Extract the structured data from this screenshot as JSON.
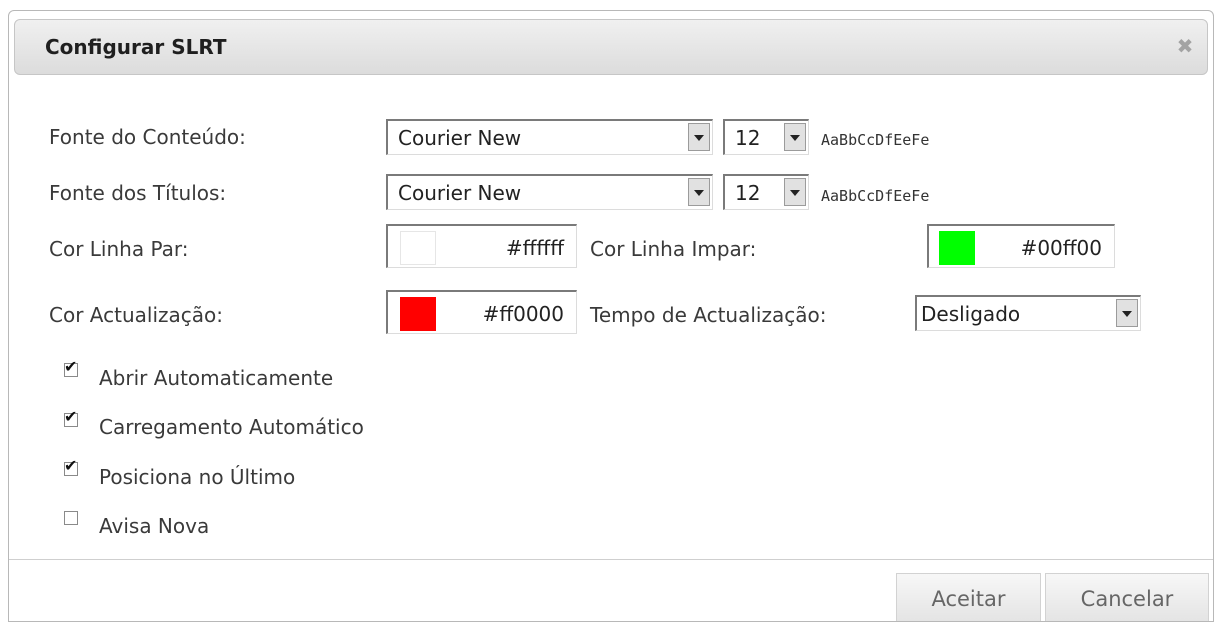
{
  "dialog": {
    "title": "Configurar SLRT",
    "close_icon": "close-icon"
  },
  "content_font": {
    "label": "Fonte do Conteúdo:",
    "family": "Courier New",
    "size": "12",
    "sample": "AaBbCcDfEeFe"
  },
  "title_font": {
    "label": "Fonte dos Títulos:",
    "family": "Courier New",
    "size": "12",
    "sample": "AaBbCcDfEeFe"
  },
  "even_row_color": {
    "label": "Cor Linha Par:",
    "value": "#ffffff",
    "swatch": "#ffffff"
  },
  "odd_row_color": {
    "label": "Cor Linha Impar:",
    "value": "#00ff00",
    "swatch": "#00ff00"
  },
  "update_color": {
    "label": "Cor Actualização:",
    "value": "#ff0000",
    "swatch": "#ff0000"
  },
  "update_time": {
    "label": "Tempo de Actualização:",
    "value": "Desligado"
  },
  "options": [
    {
      "label": "Abrir Automaticamente",
      "checked": true
    },
    {
      "label": "Carregamento Automático",
      "checked": true
    },
    {
      "label": "Posiciona no Último",
      "checked": true
    },
    {
      "label": "Avisa Nova",
      "checked": false
    }
  ],
  "buttons": {
    "accept": "Aceitar",
    "cancel": "Cancelar"
  }
}
